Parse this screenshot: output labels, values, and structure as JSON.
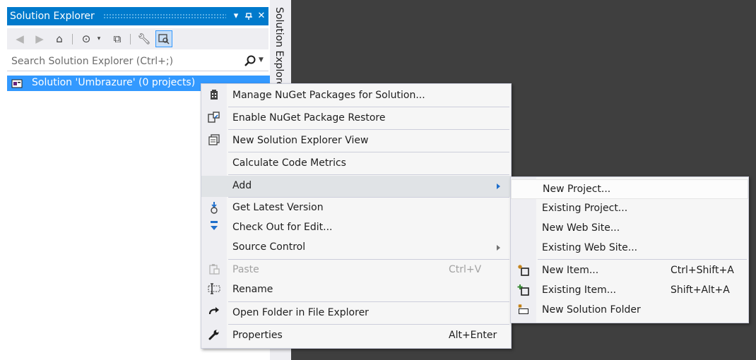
{
  "panel": {
    "title": "Solution Explorer",
    "side_tab_label": "Solution Explorer",
    "search": {
      "placeholder": "Search Solution Explorer (Ctrl+;)",
      "value": ""
    },
    "tree": {
      "root_label": "Solution 'Umbrazure' (0 projects)"
    },
    "title_buttons": [
      "dropdown-icon",
      "pin-icon",
      "close-icon"
    ],
    "toolbar_icons": [
      "back-icon",
      "forward-icon",
      "home-icon",
      "pending-changes-icon",
      "collapse-all-icon",
      "properties-icon",
      "preview-icon"
    ]
  },
  "context_menu": {
    "items": [
      {
        "label": "Manage NuGet Packages for Solution...",
        "shortcut": "",
        "icon": "nuget-icon"
      },
      {
        "label": "Enable NuGet Package Restore",
        "shortcut": "",
        "icon": "package-restore-icon"
      },
      {
        "label": "New Solution Explorer View",
        "shortcut": "",
        "icon": "new-view-icon"
      },
      {
        "label": "Calculate Code Metrics",
        "shortcut": "",
        "icon": ""
      },
      {
        "label": "Add",
        "shortcut": "",
        "icon": ""
      },
      {
        "label": "Get Latest Version",
        "shortcut": "",
        "icon": "get-latest-icon"
      },
      {
        "label": "Check Out for Edit...",
        "shortcut": "",
        "icon": "check-out-icon"
      },
      {
        "label": "Source Control",
        "shortcut": "",
        "icon": ""
      },
      {
        "label": "Paste",
        "shortcut": "Ctrl+V",
        "icon": "paste-icon"
      },
      {
        "label": "Rename",
        "shortcut": "",
        "icon": "rename-icon"
      },
      {
        "label": "Open Folder in File Explorer",
        "shortcut": "",
        "icon": "open-folder-icon"
      },
      {
        "label": "Properties",
        "shortcut": "Alt+Enter",
        "icon": "wrench-icon"
      }
    ]
  },
  "add_submenu": {
    "items": [
      {
        "label": "New Project...",
        "shortcut": ""
      },
      {
        "label": "Existing Project...",
        "shortcut": ""
      },
      {
        "label": "New Web Site...",
        "shortcut": ""
      },
      {
        "label": "Existing Web Site...",
        "shortcut": ""
      },
      {
        "label": "New Item...",
        "shortcut": "Ctrl+Shift+A",
        "icon": "new-item-icon"
      },
      {
        "label": "Existing Item...",
        "shortcut": "Shift+Alt+A",
        "icon": "existing-item-icon"
      },
      {
        "label": "New Solution Folder",
        "shortcut": "",
        "icon": "new-folder-icon"
      }
    ]
  },
  "colors": {
    "accent": "#007acc",
    "selection": "#3399ff",
    "background": "#3f3f3f"
  }
}
